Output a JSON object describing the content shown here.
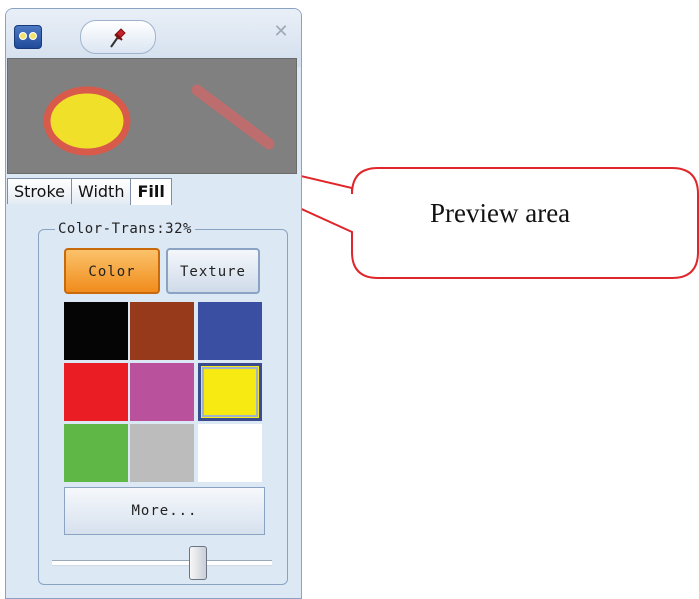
{
  "panel": {
    "close_symbol": "✕",
    "icons": [
      "app-icon",
      "pin-icon",
      "close-icon"
    ]
  },
  "preview": {
    "shapes": [
      "ellipse",
      "line"
    ],
    "ellipse_fill": "#f0e02a",
    "ellipse_stroke": "#d85a4a",
    "line_stroke": "#c86a6a"
  },
  "tabs": [
    {
      "label": "Stroke",
      "active": false
    },
    {
      "label": "Width",
      "active": false
    },
    {
      "label": "Fill",
      "active": true
    }
  ],
  "fill": {
    "group_title": "Color-Trans:32%",
    "transparency_percent": 32,
    "color_button": "Color",
    "texture_button": "Texture",
    "selected_mode": "Color",
    "swatches": [
      {
        "color": "#050505",
        "selected": false
      },
      {
        "color": "#973a1c",
        "selected": false
      },
      {
        "color": "#3a4fa2",
        "selected": false
      },
      {
        "color": "#ea1c24",
        "selected": false
      },
      {
        "color": "#b9519c",
        "selected": false
      },
      {
        "color": "#f7ea13",
        "selected": true
      },
      {
        "color": "#5fb846",
        "selected": false
      },
      {
        "color": "#bcbcbc",
        "selected": false
      },
      {
        "color": "#ffffff",
        "selected": false
      }
    ],
    "more_button": "More...",
    "slider_value_fraction": 0.68
  },
  "callout": {
    "text": "Preview area",
    "stroke": "#e0262a"
  }
}
